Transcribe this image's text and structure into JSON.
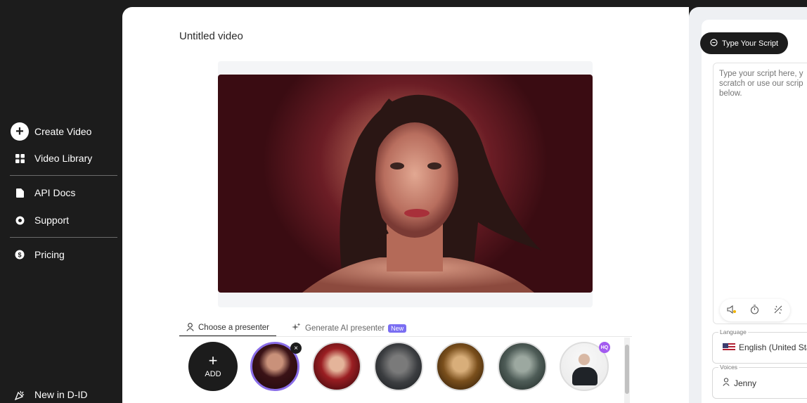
{
  "sidebar": {
    "items": [
      {
        "label": "Create Video",
        "icon": "plus-circle-icon"
      },
      {
        "label": "Video Library",
        "icon": "grid-icon"
      },
      {
        "label": "API Docs",
        "icon": "document-icon"
      },
      {
        "label": "Support",
        "icon": "lifebuoy-icon"
      },
      {
        "label": "Pricing",
        "icon": "dollar-icon"
      },
      {
        "label": "New in D-ID",
        "icon": "party-icon"
      }
    ]
  },
  "main": {
    "title": "Untitled video",
    "tabs": [
      {
        "label": "Choose a presenter",
        "icon": "user-icon",
        "active": true
      },
      {
        "label": "Generate AI presenter",
        "icon": "sparkle-icon",
        "badge": "New",
        "active": false
      }
    ],
    "presenters": {
      "add_label": "ADD",
      "add_symbol": "+",
      "hq_badge": "HQ",
      "remove_symbol": "×"
    }
  },
  "script_panel": {
    "type_script_label": "Type Your Script",
    "script_placeholder": "Type your script here, y scratch or use our scrip below.",
    "tools": [
      "volume-icon",
      "timer-icon",
      "sparkle-icon"
    ],
    "language_legend": "Language",
    "language_value": "English (United Stat",
    "voices_legend": "Voices",
    "voice_value": "Jenny"
  },
  "colors": {
    "sidebar_bg": "#1c1c1c",
    "accent_purple": "#8a6ee8",
    "new_badge": "#7a6ef2"
  }
}
